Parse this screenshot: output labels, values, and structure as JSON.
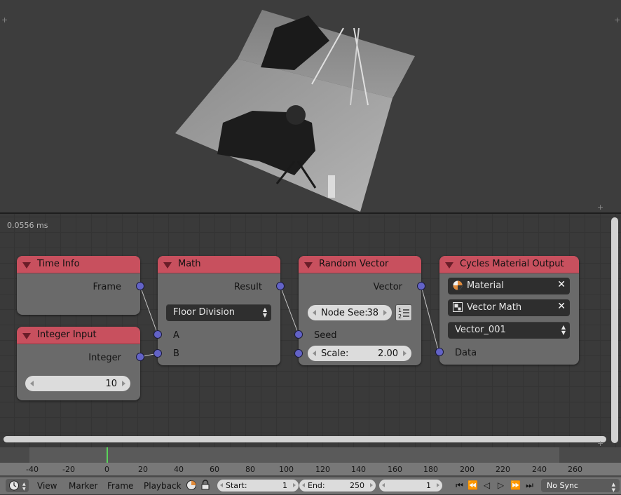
{
  "viewport": {},
  "node_editor": {
    "execution_time": "0.0556 ms",
    "nodes": {
      "time_info": {
        "title": "Time Info",
        "output": "Frame"
      },
      "integer_input": {
        "title": "Integer Input",
        "output": "Integer",
        "value": "10"
      },
      "math": {
        "title": "Math",
        "output": "Result",
        "operation": "Floor Division",
        "input_a": "A",
        "input_b": "B"
      },
      "random_vector": {
        "title": "Random Vector",
        "output": "Vector",
        "seed_field_label": "Node See:",
        "seed_field_value": "38",
        "input_seed": "Seed",
        "scale_label": "Scale:",
        "scale_value": "2.00"
      },
      "cycles_output": {
        "title": "Cycles Material Output",
        "material": "Material",
        "node_name": "Vector Math",
        "vector_dropdown": "Vector_001",
        "input_data": "Data"
      }
    },
    "colors": {
      "node_header": "#c8505e",
      "socket": "#6363c7"
    }
  },
  "timeline": {
    "ticks": [
      "-40",
      "-20",
      "0",
      "20",
      "40",
      "60",
      "80",
      "100",
      "120",
      "140",
      "160",
      "180",
      "200",
      "220",
      "240",
      "260"
    ],
    "current_frame_marker": 0
  },
  "header": {
    "menus": {
      "view": "View",
      "marker": "Marker",
      "frame": "Frame",
      "playback": "Playback"
    },
    "start_label": "Start:",
    "start_value": "1",
    "end_label": "End:",
    "end_value": "250",
    "current_frame": "1",
    "sync": "No Sync"
  }
}
